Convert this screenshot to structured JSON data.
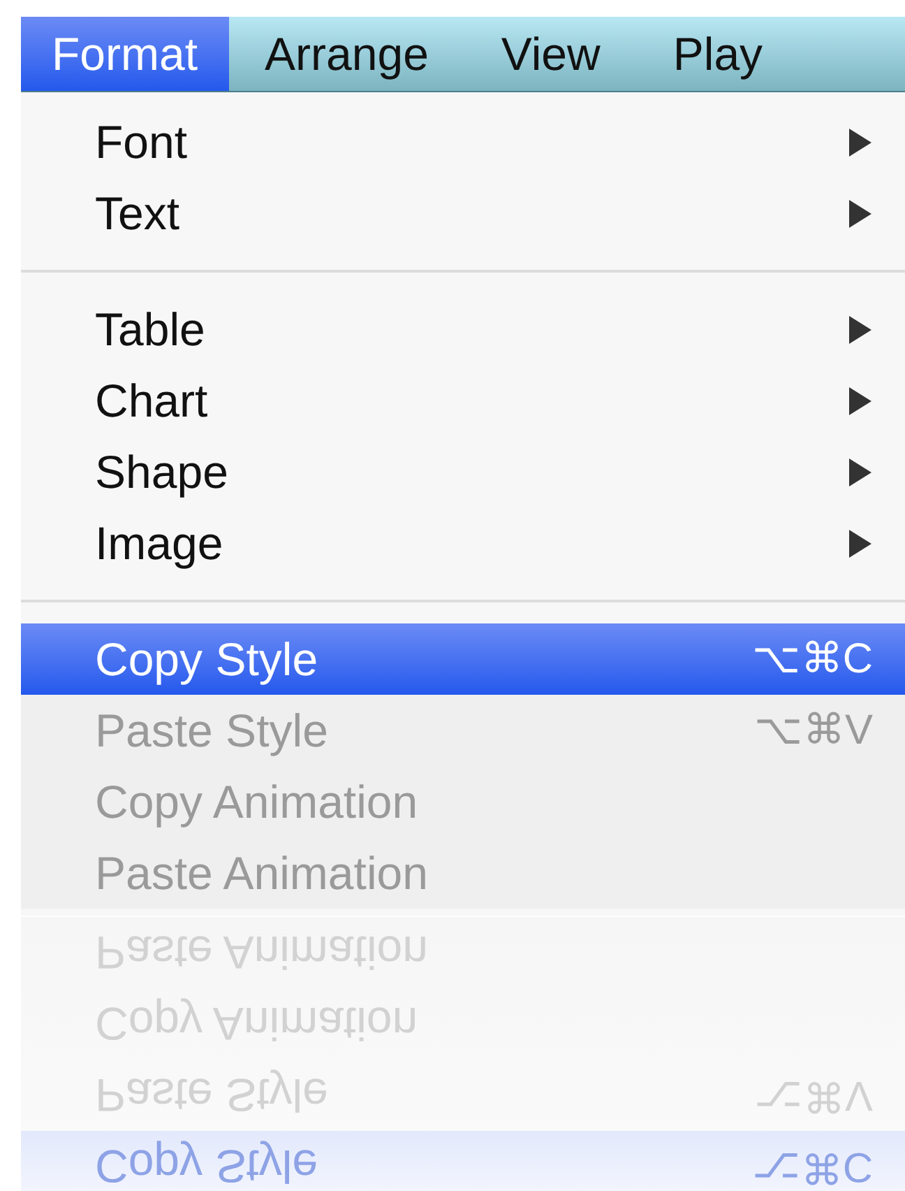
{
  "menu_bar": [
    {
      "label": "Format",
      "selected": true
    },
    {
      "label": "Arrange",
      "selected": false
    },
    {
      "label": "View",
      "selected": false
    },
    {
      "label": "Play",
      "selected": false
    }
  ],
  "menu": [
    {
      "kind": "item",
      "label": "Font",
      "submenu": true,
      "selected": false,
      "disabled": false
    },
    {
      "kind": "item",
      "label": "Text",
      "submenu": true,
      "selected": false,
      "disabled": false
    },
    {
      "kind": "separator"
    },
    {
      "kind": "item",
      "label": "Table",
      "submenu": true,
      "selected": false,
      "disabled": false
    },
    {
      "kind": "item",
      "label": "Chart",
      "submenu": true,
      "selected": false,
      "disabled": false
    },
    {
      "kind": "item",
      "label": "Shape",
      "submenu": true,
      "selected": false,
      "disabled": false
    },
    {
      "kind": "item",
      "label": "Image",
      "submenu": true,
      "selected": false,
      "disabled": false
    },
    {
      "kind": "separator"
    },
    {
      "kind": "item",
      "label": "Copy Style",
      "shortcut": "⌥⌘C",
      "submenu": false,
      "selected": true,
      "disabled": false
    },
    {
      "kind": "item",
      "label": "Paste Style",
      "shortcut": "⌥⌘V",
      "submenu": false,
      "selected": false,
      "disabled": true
    },
    {
      "kind": "item",
      "label": "Copy Animation",
      "submenu": false,
      "selected": false,
      "disabled": true
    },
    {
      "kind": "item",
      "label": "Paste Animation",
      "submenu": false,
      "selected": false,
      "disabled": true
    }
  ],
  "reflection": [
    {
      "label": "Paste Animation",
      "selected": false
    },
    {
      "label": "Copy Animation",
      "selected": false
    },
    {
      "label": "Paste Style",
      "shortcut": "⌥⌘V",
      "selected": false
    },
    {
      "label": "Copy Style",
      "shortcut": "⌥⌘C",
      "selected": true
    }
  ]
}
